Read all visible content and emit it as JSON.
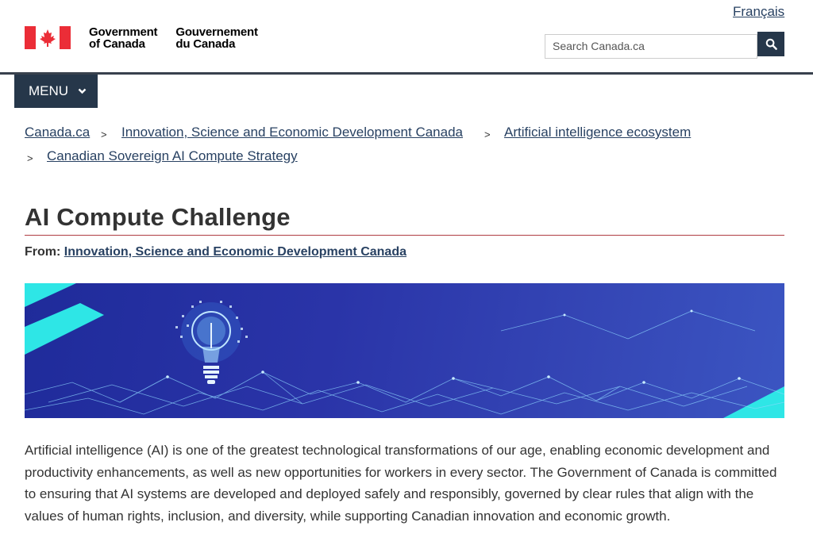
{
  "header": {
    "language_link": "Français",
    "wordmark_en_line1": "Government",
    "wordmark_en_line2": "of Canada",
    "wordmark_fr_line1": "Gouvernement",
    "wordmark_fr_line2": "du Canada",
    "search_placeholder": "Search Canada.ca",
    "search_icon": "search-icon",
    "menu_label": "MENU",
    "menu_icon": "chevron-down-icon"
  },
  "breadcrumb": {
    "items": [
      "Canada.ca",
      "Innovation, Science and Economic Development Canada",
      "Artificial intelligence ecosystem",
      "Canadian Sovereign AI Compute Strategy"
    ],
    "separator": ">"
  },
  "page": {
    "title": "AI Compute Challenge",
    "from_label": "From:",
    "from_org": "Innovation, Science and Economic Development Canada",
    "intro": "Artificial intelligence (AI) is one of the greatest technological transformations of our age, enabling economic development and productivity enhancements, as well as new opportunities for workers in every sector. The Government of Canada is committed to ensuring that AI systems are developed and deployed safely and responsibly, governed by clear rules that align with the values of human rights, inclusion, and diversity, while supporting Canadian innovation and economic growth."
  },
  "colors": {
    "brand_dark": "#26374a",
    "link": "#284162",
    "title_rule": "#af3c43",
    "flag_red": "#eb2d37",
    "banner_blue": "#2a34a8",
    "banner_accent": "#2ee6e6"
  }
}
